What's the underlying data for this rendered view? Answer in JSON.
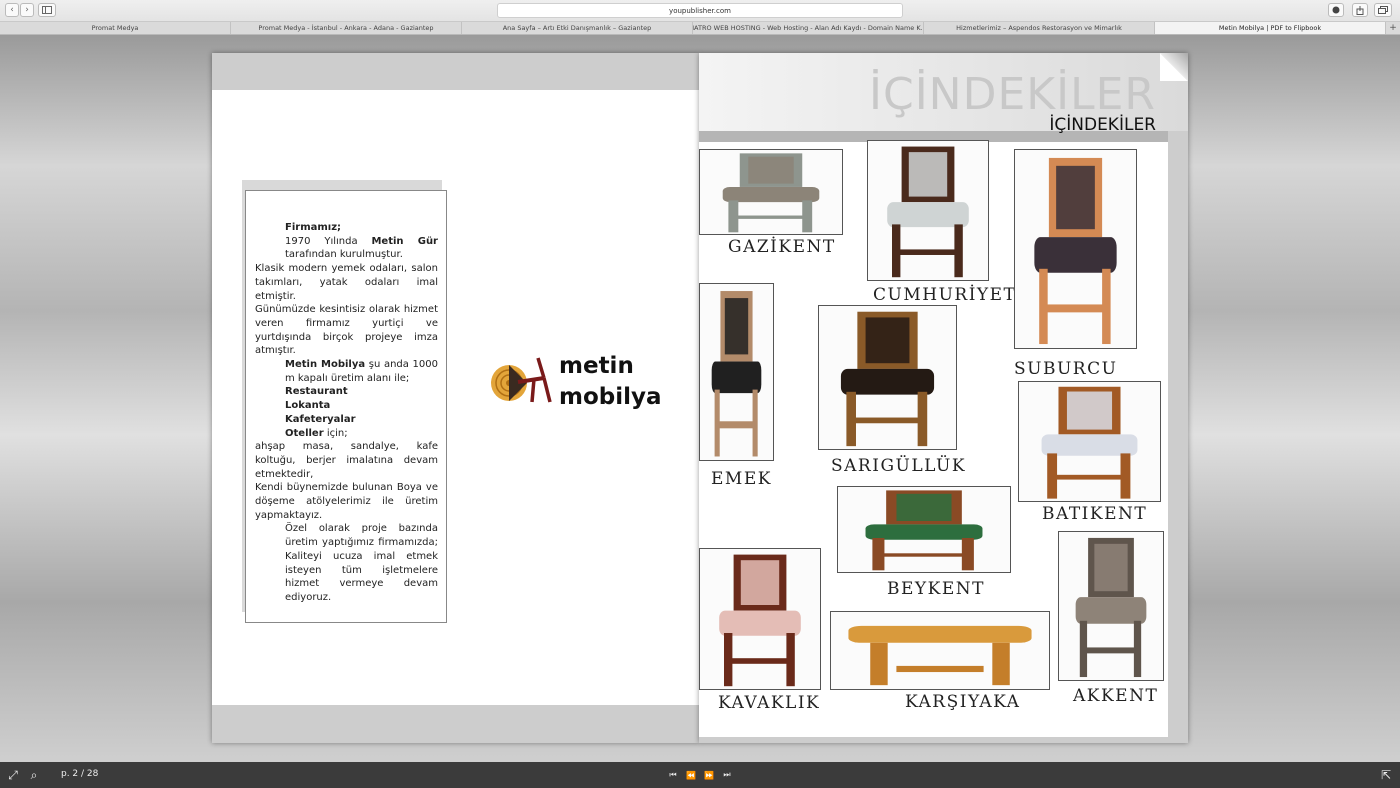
{
  "browser": {
    "url": "youpublisher.com",
    "tabs": [
      "Promat Medya",
      "Promat Medya - İstanbul - Ankara - Adana - Gaziantep",
      "Ana Sayfa – Artı Etki Danışmanlık – Gaziantep",
      "NATRO WEB HOSTING - Web Hosting - Alan Adı Kaydı - Domain Name K...",
      "Hizmetlerimiz – Aspendos Restorasyon ve Mimarlık",
      "Metin Mobilya | PDF to Flipbook"
    ],
    "back_glyph": "‹",
    "forward_glyph": "›",
    "new_tab_glyph": "+"
  },
  "left_page": {
    "paragraphs": [
      {
        "bold": "Firmamız;",
        "text": "",
        "indent": true
      },
      {
        "bold": "",
        "text": "1970 Yılında ",
        "bold2": "Metin Gür",
        "text2": " tarafından kurulmuştur.",
        "indent": true
      },
      {
        "text": "Klasik modern yemek odaları, salon takımları, yatak odaları imal etmiştir."
      },
      {
        "text": "Günümüzde kesintisiz olarak hizmet veren firmamız yurtiçi ve yurtdışında birçok projeye imza atmıştır."
      },
      {
        "bold": "Metin Mobilya",
        "text": " şu anda 1000 m kapalı üretim alanı ile;",
        "indent": true
      },
      {
        "bold": "Restaurant",
        "indent": true
      },
      {
        "bold": "Lokanta",
        "indent": true
      },
      {
        "bold": "Kafeteryalar",
        "indent": true
      },
      {
        "bold": "Oteller",
        "text": " için;",
        "indent": true
      },
      {
        "text": "ahşap masa, sandalye, kafe koltuğu, berjer imalatına devam etmektedir,"
      },
      {
        "text": "Kendi büynemizde bulunan Boya ve döşeme atölyelerimiz ile üretim yapmaktayız."
      },
      {
        "text": "Özel olarak proje bazında üretim yaptığımız firmamızda; Kaliteyi ucuza imal etmek isteyen tüm işletmelere hizmet vermeye devam ediyoruz.",
        "indent": true
      }
    ],
    "logo_line1": "metin",
    "logo_line2": "mobilya"
  },
  "right_page": {
    "heading_big": "İÇİNDEKİLER",
    "heading_small": "İÇİNDEKİLER",
    "products": [
      {
        "name": "GAZİKENT",
        "seat": "#8c8478",
        "wood": "#8e958e"
      },
      {
        "name": "CUMHURİYET",
        "seat": "#cfd4d4",
        "wood": "#4a2a1c"
      },
      {
        "name": "SUBURCU",
        "seat": "#3a3039",
        "wood": "#d48a54"
      },
      {
        "name": "EMEK",
        "seat": "#202020",
        "wood": "#b38b6a"
      },
      {
        "name": "SARIGÜLLÜK",
        "seat": "#241a14",
        "wood": "#8a5a28"
      },
      {
        "name": "BATIKENT",
        "seat": "#d9dde6",
        "wood": "#a25a25"
      },
      {
        "name": "BEYKENT",
        "seat": "#2d6e3e",
        "wood": "#8a4a25"
      },
      {
        "name": "KAVAKLIK",
        "seat": "#e4bdb6",
        "wood": "#6a2a1a"
      },
      {
        "name": "KARŞIYAKA",
        "seat": "#d99a3c",
        "wood": "#c47e2a"
      },
      {
        "name": "AKKENT",
        "seat": "#8e8378",
        "wood": "#5f554c"
      }
    ]
  },
  "viewer": {
    "page_indicator": "p. 2 / 28",
    "fullscreen_glyph": "⤢",
    "zoom_glyph": "⌕",
    "share_glyph": "⇱",
    "controls": [
      "⏮",
      "⏪",
      "⏩",
      "⏭"
    ]
  },
  "colors": {
    "accent": "#e3a53a",
    "toolbar": "#3b3b3b"
  }
}
